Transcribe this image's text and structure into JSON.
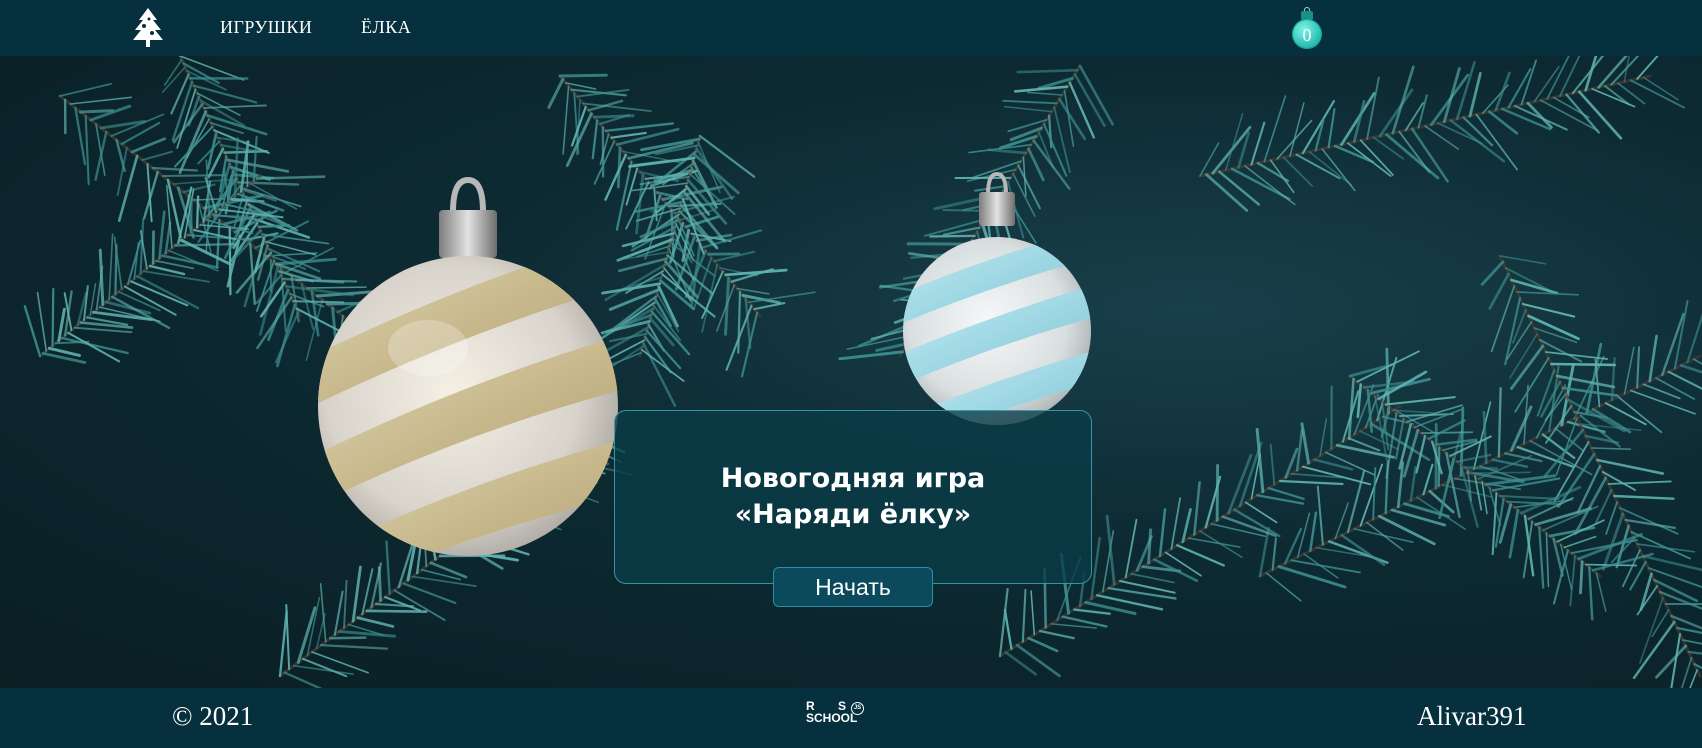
{
  "header": {
    "logo_icon": "christmas-tree-icon",
    "nav": [
      {
        "label": "ИГРУШКИ"
      },
      {
        "label": "ЁЛКА"
      }
    ],
    "selected_counter": "0",
    "counter_icon": "ornament-ball-icon"
  },
  "main": {
    "title_line1": "Новогодняя игра",
    "title_line2": "«Наряди ёлку»",
    "start_label": "Начать"
  },
  "footer": {
    "copyright": "© 2021",
    "school_logo_letters": {
      "r": "R",
      "s": "S",
      "js": "JS",
      "word": "SCHOOL"
    },
    "author": "Alivar391"
  },
  "colors": {
    "header_bg": "#06303d",
    "card_border": "#43aabe",
    "button_bg": "#0b4a5d",
    "counter_accent": "#23b9ad"
  }
}
